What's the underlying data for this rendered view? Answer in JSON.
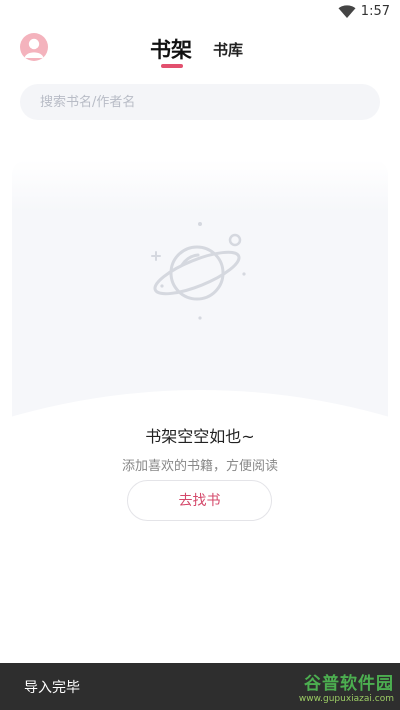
{
  "status_bar": {
    "time": "1:57",
    "wifi_icon": "wifi-icon"
  },
  "header": {
    "avatar_icon": "user-avatar-icon",
    "tabs": [
      {
        "label": "书架",
        "active": true
      },
      {
        "label": "书库",
        "active": false
      }
    ],
    "accent_color": "#e2506e"
  },
  "search": {
    "placeholder": "搜索书名/作者名",
    "value": ""
  },
  "empty_state": {
    "illustration_icon": "planet-icon",
    "title": "书架空空如也~",
    "subtitle": "添加喜欢的书籍，方便阅读",
    "button_label": "去找书"
  },
  "toast": {
    "message": "导入完毕"
  },
  "watermark": {
    "text": "谷普软件园",
    "url": "www.gupuxiazai.com"
  }
}
